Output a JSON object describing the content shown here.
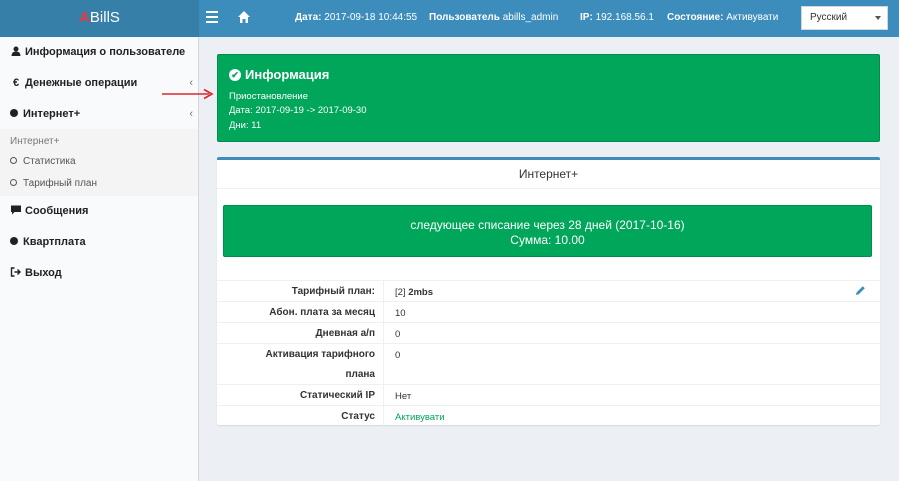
{
  "logo": {
    "first": "A",
    "rest": "BillS"
  },
  "topbar": {
    "date_label": "Дата:",
    "date_value": "2017-09-18 10:44:55",
    "user_label": "Пользователь",
    "user_value": "abills_admin",
    "ip_label": "IP:",
    "ip_value": "192.168.56.1",
    "state_label": "Состояние:",
    "state_value": "Активувати",
    "language": "Русский"
  },
  "sidebar": {
    "user_info": "Информация о пользователе",
    "money": "Денежные операции",
    "internet": "Интернет+",
    "sub_header": "Интернет+",
    "stats": "Статистика",
    "tariff": "Тарифный план",
    "messages": "Сообщения",
    "rent": "Квартплата",
    "logout": "Выход"
  },
  "info": {
    "title": "Информация",
    "status": "Приостановление",
    "date": "Дата: 2017-09-19 -> 2017-09-30",
    "days": "Дни: 11"
  },
  "panel": {
    "title": "Интернет+",
    "charge_line1": "следующее списание через 28 дней (2017-10-16)",
    "charge_line2": "Сумма: 10.00"
  },
  "table": {
    "tariff_label": "Тарифный план:",
    "tariff_id": "[2]",
    "tariff_name": "2mbs",
    "monthly_label": "Абон. плата за месяц",
    "monthly_value": "10",
    "daily_label": "Дневная а/п",
    "daily_value": "0",
    "activation_label_1": "Активация тарифного",
    "activation_label_2": "плана",
    "activation_value": "0",
    "static_ip_label": "Статический IP",
    "static_ip_value": "Нет",
    "status_label": "Статус",
    "status_value": "Активувати"
  },
  "colors": {
    "header": "#3c8dbc",
    "success": "#00a65a",
    "status_text": "#00a65a",
    "arrow": "#d9262b"
  }
}
